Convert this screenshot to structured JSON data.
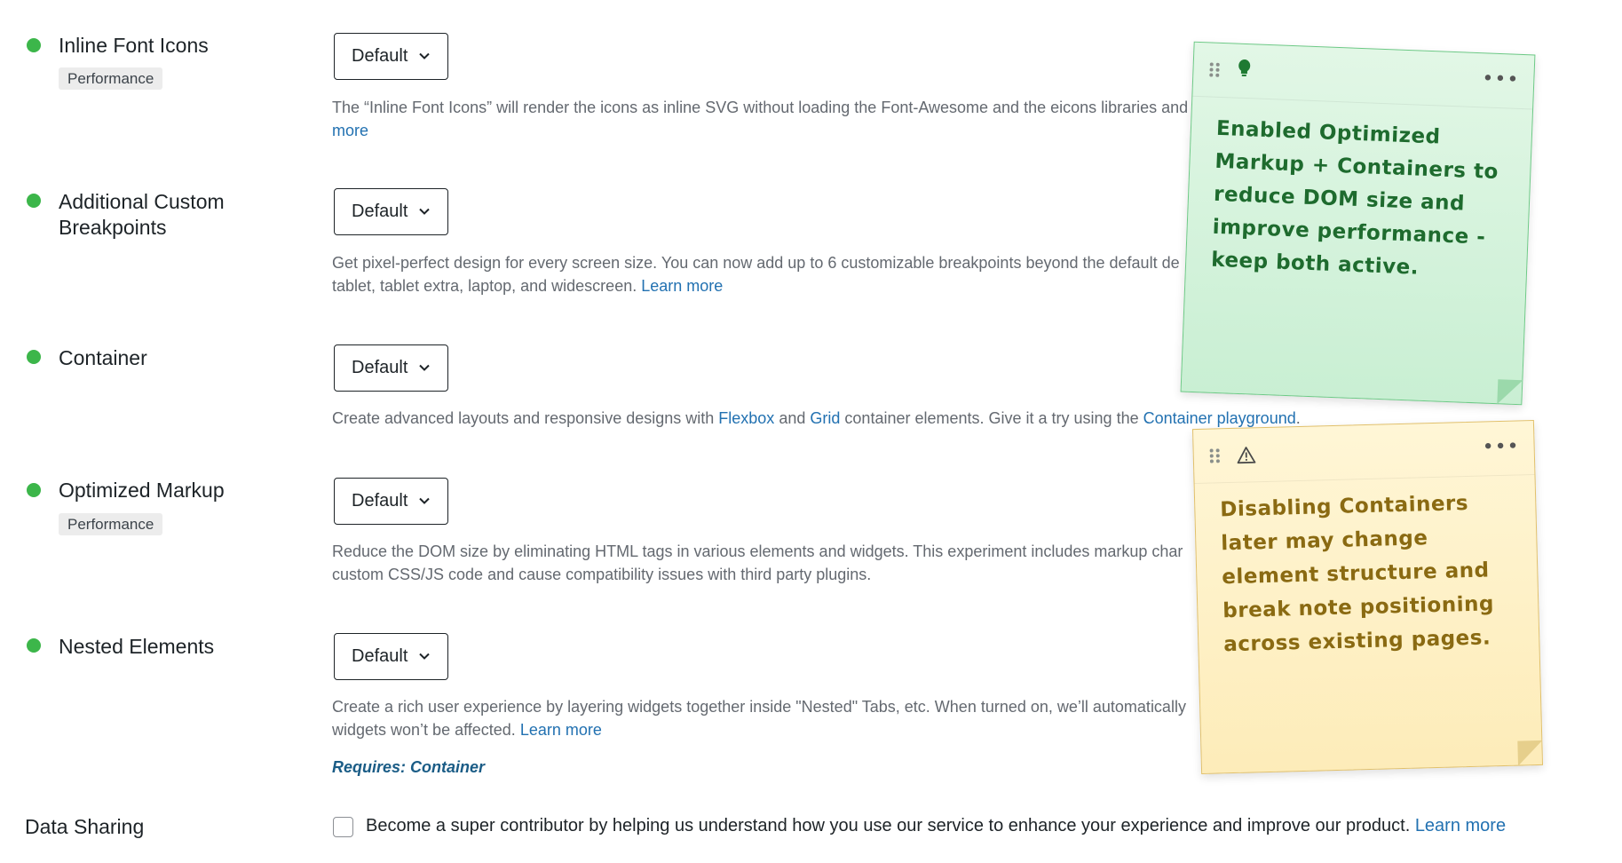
{
  "experiments": [
    {
      "label": "Inline Font Icons",
      "badge": "Performance",
      "select_value": "Default",
      "description": "The “Inline Font Icons” will render the icons as inline SVG without loading the Font-Awesome and the eicons libraries and",
      "link_text": "more"
    },
    {
      "label": "Additional Custom Breakpoints",
      "select_value": "Default",
      "description_line1": "Get pixel-perfect design for every screen size. You can now add up to 6 customizable breakpoints beyond the default de",
      "description_line2": "tablet, tablet extra, laptop, and widescreen.",
      "link_text": "Learn more"
    },
    {
      "label": "Container",
      "select_value": "Default",
      "description_part1": "Create advanced layouts and responsive designs with",
      "link_flexbox": "Flexbox",
      "description_part2": "and",
      "link_grid": "Grid",
      "description_part3": "container elements. Give it a try using the",
      "link_playground": "Container playground",
      "description_end": "."
    },
    {
      "label": "Optimized Markup",
      "badge": "Performance",
      "select_value": "Default",
      "description_line1": "Reduce the DOM size by eliminating HTML tags in various elements and widgets. This experiment includes markup char",
      "description_line2": "custom CSS/JS code and cause compatibility issues with third party plugins."
    },
    {
      "label": "Nested Elements",
      "select_value": "Default",
      "description_line1": "Create a rich user experience by layering widgets together inside \"Nested\" Tabs, etc. When turned on, we’ll automatically",
      "description_line2": "widgets won’t be affected.",
      "link_text": "Learn more",
      "requires": "Requires: Container"
    }
  ],
  "data_sharing": {
    "title": "Data Sharing",
    "text": "Become a super contributor by helping us understand how you use our service to enhance your experience and improve our product.",
    "link_text": "Learn more",
    "checked": false
  },
  "notes": [
    {
      "color": "green",
      "icon": "lightbulb-icon",
      "menu": "•••",
      "text": "Enabled Optimized Markup + Containers to reduce DOM size and improve performance - keep both active."
    },
    {
      "color": "yellow",
      "icon": "warning-icon",
      "menu": "•••",
      "text": "Disabling Containers later may change element structure and break note positioning across existing pages."
    }
  ],
  "colors": {
    "status_dot": "#3cb64a",
    "link": "#2271b1",
    "requires": "#1a5c86",
    "note_green_text": "#1e6b2e",
    "note_yellow_text": "#8a6a12"
  }
}
